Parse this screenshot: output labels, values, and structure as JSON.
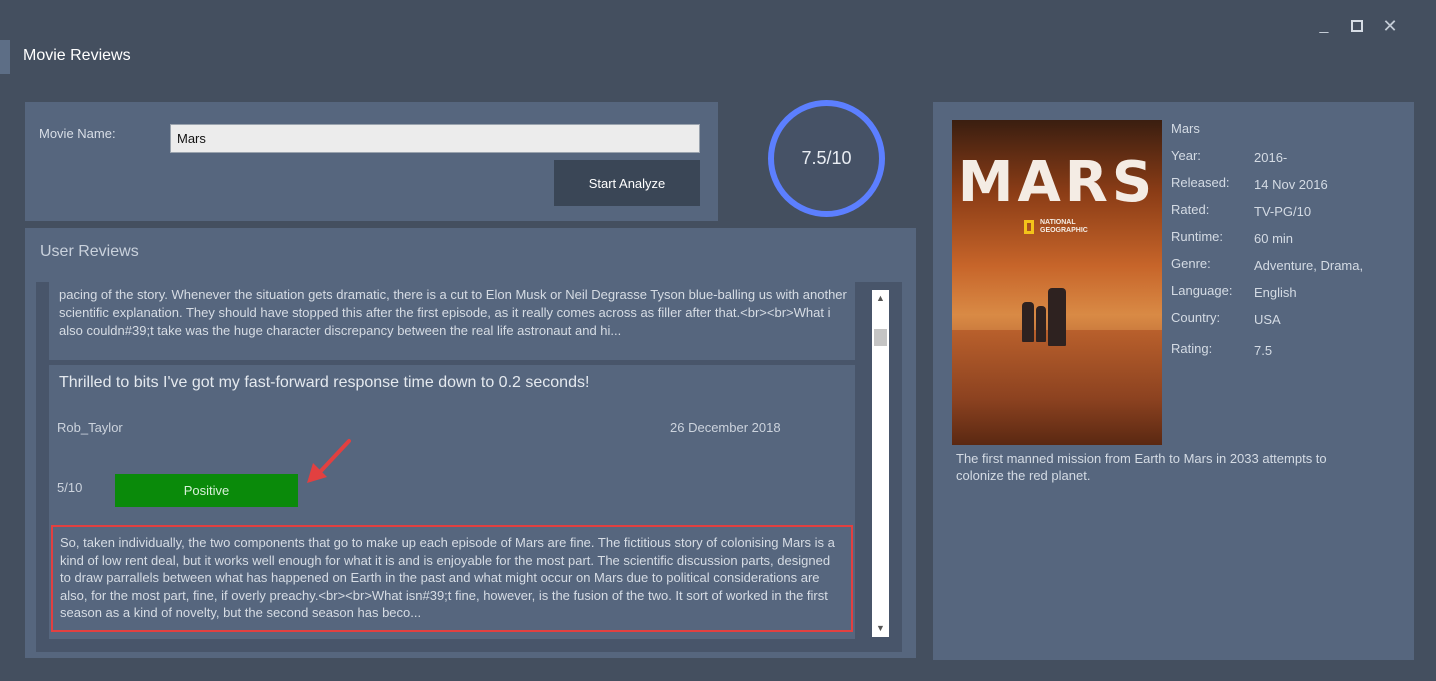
{
  "app": {
    "title": "Movie Reviews"
  },
  "window_controls": {
    "minimize": "_",
    "close": "✕"
  },
  "search": {
    "label": "Movie Name:",
    "value": "Mars",
    "button": "Start Analyze"
  },
  "score": {
    "text": "7.5/10"
  },
  "reviews": {
    "heading": "User Reviews",
    "items": [
      {
        "body": "pacing of the story. Whenever the situation gets dramatic, there is a cut to Elon Musk or Neil Degrasse Tyson blue-balling us with another scientific explanation. They should have stopped this after the first episode, as it really comes across as filler after that.<br><br>What i also couldn#39;t take was the huge character discrepancy between the real life astronaut and hi..."
      },
      {
        "title": "Thrilled to bits I've got my fast-forward response time down to 0.2 seconds!",
        "author": "Rob_Taylor",
        "date": "26 December 2018",
        "rating": "5/10",
        "sentiment": "Positive",
        "body": "So, taken individually, the two components that go to make up each episode of Mars are fine. The fictitious story of colonising Mars is a kind of low rent deal, but it works well enough for what it is and is enjoyable for the most part. The scientific discussion parts, designed to draw parrallels between what has happened on Earth in the past and what might occur on Mars due to political considerations are also, for the most part, fine, if overly preachy.<br><br>What isn#39;t fine, however, is the fusion of the two. It sort of worked in the first season as a kind of novelty, but the second season has beco..."
      }
    ],
    "scroll_up": "▲",
    "scroll_down": "▼"
  },
  "movie": {
    "name": "Mars",
    "poster_title": "MARS",
    "poster_brand": "NATIONAL GEOGRAPHIC",
    "fields": [
      {
        "label": "Year:",
        "value": "2016-"
      },
      {
        "label": "Released:",
        "value": "14 Nov 2016"
      },
      {
        "label": "Rated:",
        "value": "TV-PG/10"
      },
      {
        "label": "Runtime:",
        "value": "60 min"
      },
      {
        "label": "Genre:",
        "value": "Adventure, Drama,"
      },
      {
        "label": "Language:",
        "value": "English"
      },
      {
        "label": "Country:",
        "value": "USA"
      },
      {
        "label": "Rating:",
        "value": "7.5"
      }
    ],
    "plot": "The first manned mission from Earth to Mars in 2033 attempts to colonize the red planet."
  },
  "colors": {
    "background": "#444f5f",
    "panel": "#56667e",
    "score_ring": "#5c7fff",
    "positive": "#0a8a0a",
    "highlight": "#e24040"
  }
}
